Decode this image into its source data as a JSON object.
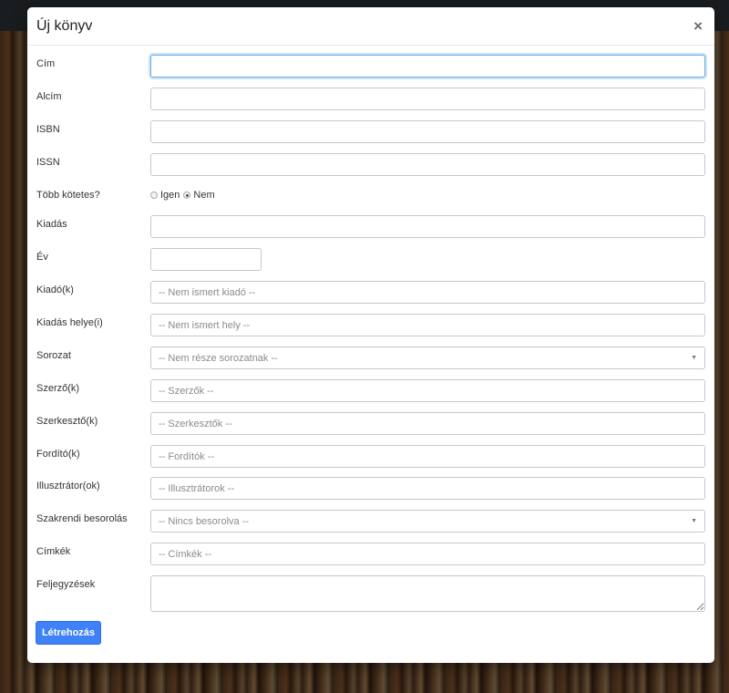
{
  "modal": {
    "title": "Új könyv",
    "close_label": "×",
    "submit_label": "Létrehozás"
  },
  "form": {
    "title_label": "Cím",
    "subtitle_label": "Alcím",
    "isbn_label": "ISBN",
    "issn_label": "ISSN",
    "multi_volume_label": "Több kötetes?",
    "multi_volume_options": [
      "Igen",
      "Nem"
    ],
    "multi_volume_selected": "Nem",
    "edition_label": "Kiadás",
    "year_label": "Év",
    "publisher_label": "Kiadó(k)",
    "publisher_placeholder": "-- Nem ismert kiadó --",
    "place_label": "Kiadás helye(i)",
    "place_placeholder": "-- Nem ismert hely --",
    "series_label": "Sorozat",
    "series_value": "-- Nem része sorozatnak --",
    "authors_label": "Szerző(k)",
    "authors_placeholder": "-- Szerzők --",
    "editors_label": "Szerkesztő(k)",
    "editors_placeholder": "-- Szerkesztők --",
    "translators_label": "Fordító(k)",
    "translators_placeholder": "-- Fordítók --",
    "illustrators_label": "Illusztrátor(ok)",
    "illustrators_placeholder": "-- Illusztrátorok --",
    "classification_label": "Szakrendi besorolás",
    "classification_value": "-- Nincs besorolva --",
    "tags_label": "Címkék",
    "tags_placeholder": "-- Címkék --",
    "notes_label": "Feljegyzések"
  },
  "icons": {
    "close": "close-icon",
    "dropdown": "chevron-down-icon"
  },
  "colors": {
    "primary_button": "#3f82f7",
    "focus_border": "#66afe9"
  }
}
